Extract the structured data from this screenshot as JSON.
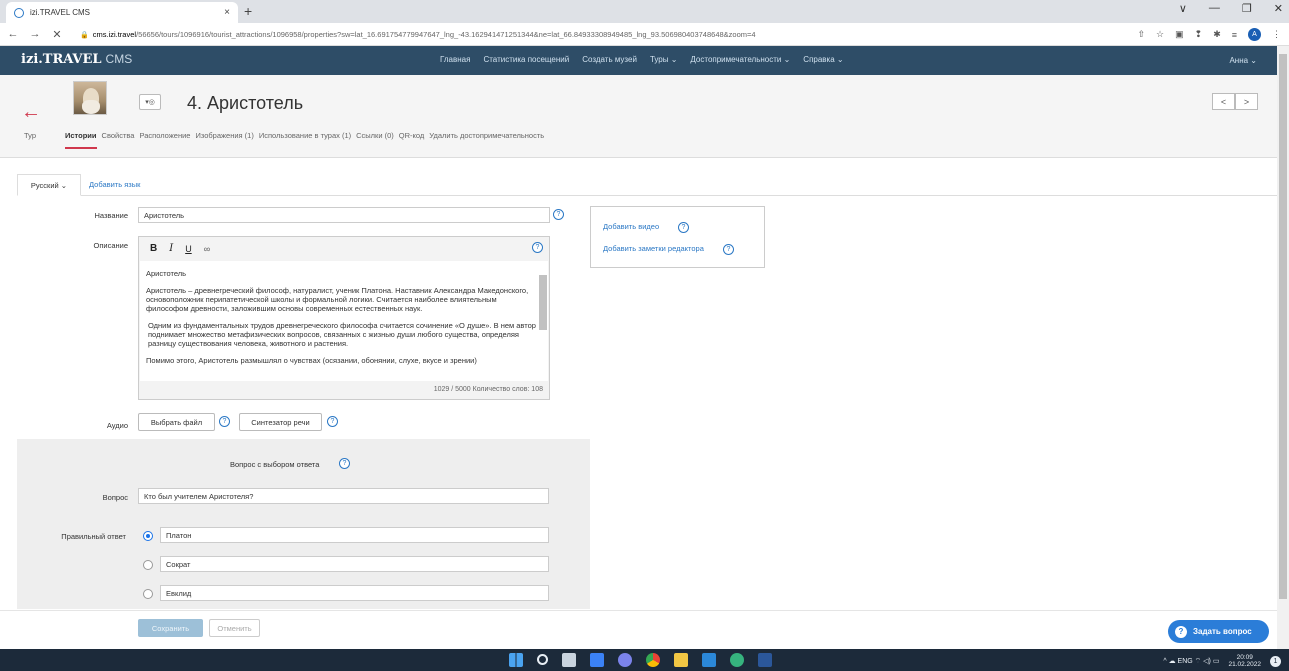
{
  "browser": {
    "tab_title": "izi.TRAVEL CMS",
    "tab_close": "×",
    "new_tab": "+",
    "url_host": "cms.izi.travel",
    "url_path": "/56656/tours/1096916/tourist_attractions/1096958/properties?sw=lat_16.691754779947647_lng_-43.162941471251344&ne=lat_66.84933308949485_lng_93.506980403748648&zoom=4",
    "profile_initial": "A",
    "window_controls": [
      "∨",
      "—",
      "❐",
      "✕"
    ],
    "nav": [
      "←",
      "→",
      "✕"
    ],
    "ext_icons": [
      "⇧",
      "☆",
      "▣",
      "❢",
      "✱",
      "≡"
    ]
  },
  "app": {
    "logo_main": "izi.TRAVEL",
    "logo_sub": "CMS",
    "menu": [
      "Главная",
      "Статистика посещений",
      "Создать музей",
      "Туры ⌄",
      "Достопримечательности ⌄",
      "Справка ⌄"
    ],
    "user": "Анна ⌄"
  },
  "header": {
    "back_icon": "←",
    "audio_icon": "▾◎",
    "title": "4. Аристотель",
    "pager_prev": "<",
    "pager_next": ">",
    "tabs": [
      "Тур",
      "Истории",
      "Свойства",
      "Расположение",
      "Изображения (1)",
      "Использование в турах (1)",
      "Ссылки (0)",
      "QR-код",
      "Удалить достопримечательность"
    ]
  },
  "language": {
    "current": "Русский ⌄",
    "add": "Добавить язык"
  },
  "form": {
    "name_label": "Название",
    "name_value": "Аристотель",
    "description_label": "Описание",
    "toolbar": {
      "bold": "B",
      "italic": "I",
      "underline": "U",
      "link": "🔗"
    },
    "description_paragraphs": [
      "Аристотель",
      "Аристотель – древнегреческий философ, натуралист, ученик Платона. Наставник Александра Македонского, основоположник перипатетической школы и формальной логики. Считается наиболее влиятельным философом древности, заложившим основы современных естественных наук.",
      "Одним из фундаментальных трудов древнегреческого философа считается сочинение «О душе». В нем автор поднимает множество метафизических вопросов, связанных с жизнью души любого существа, определяя разницу существования человека, животного и растения.",
      "Помимо этого, Аристотель размышлял о чувствах (осязании, обонянии, слухе, вкусе и зрении)"
    ],
    "counter": "1029 / 5000   Количество слов: 108",
    "audio_label": "Аудио",
    "choose_file": "Выбрать файл",
    "speech_synth": "Синтезатор речи",
    "help": "?",
    "side_links": {
      "add_video": "Добавить видео",
      "add_editor_notes": "Добавить заметки редактора"
    }
  },
  "quiz": {
    "header": "Вопрос с выбором ответа",
    "question_label": "Вопрос",
    "question_value": "Кто был учителем Аристотеля?",
    "answer_label": "Правильный ответ",
    "answers": [
      {
        "text": "Платон",
        "selected": true
      },
      {
        "text": "Сократ",
        "selected": false
      },
      {
        "text": "Евклид",
        "selected": false
      }
    ]
  },
  "actions": {
    "save": "Сохранить",
    "cancel": "Отменить",
    "ask": "Задать вопрос",
    "ask_icon": "?"
  },
  "taskbar": {
    "tray_text": "^  ☁  ENG  ⌔ ◁) ▭",
    "time": "20:09",
    "date": "21.02.2022",
    "notifications": "1"
  },
  "colors": {
    "topnav": "#2e4d67",
    "accent": "#d0384d",
    "link": "#2b78c5",
    "ask_button": "#2b7dd8"
  }
}
